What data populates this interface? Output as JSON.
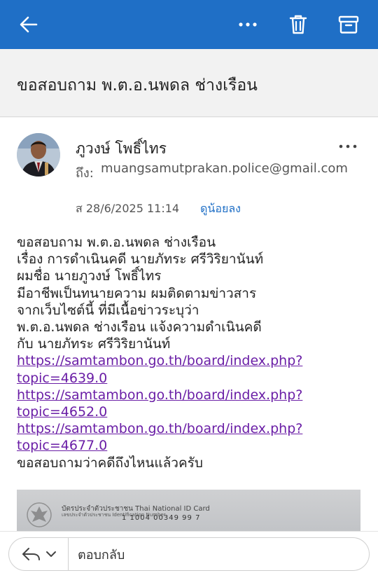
{
  "toolbar": {
    "back_icon": "arrow-left-icon",
    "more_icon": "more-horizontal-icon",
    "delete_icon": "trash-icon",
    "archive_icon": "archive-icon",
    "color": "#1f6fc6"
  },
  "email": {
    "subject": "ขอสอบถาม พ.ต.อ.นพดล ช่างเรือน",
    "sender_name": "ภูวงษ์ โพธิ์ไทร",
    "to_label": "ถึง:",
    "to_address": "muangsamutprakan.police@gmail.com",
    "date": "ส 28/6/2025 11:14",
    "show_less": "ดูน้อยลง",
    "body_lines": [
      "ขอสอบถาม พ.ต.อ.นพดล ช่างเรือน",
      "เรื่อง การดำเนินคดี นายภัทระ ศรีวิริยานันท์",
      "ผมชื่อ นายภูวงษ์ โพธิ์ไทร",
      "มีอาชีพเป็นทนายความ ผมติดตามข่าวสาร",
      "จากเว็บไซต์นี้ ที่มีเนื้อข่าวระบุว่า",
      "พ.ต.อ.นพดล ช่างเรือน แจ้งความดำเนินคดี",
      "กับ นายภัทระ ศรีวิริยานันท์"
    ],
    "links": [
      {
        "line1": "https://samtambon.go.th/board/index.php?",
        "line2": "topic=4639.0"
      },
      {
        "line1": "https://samtambon.go.th/board/index.php?",
        "line2": "topic=4652.0"
      },
      {
        "line1": "https://samtambon.go.th/board/index.php?",
        "line2": "topic=4677.0"
      }
    ],
    "closing": "ขอสอบถามว่าคดีถึงไหนแล้วครับ",
    "link_color": "#6a1ea6",
    "attachment": {
      "title": "บัตรประจำตัวประชาชน Thai National ID Card",
      "id_label": "เลขประจำตัวประชาชน Identification Number",
      "id_number": "1 1004 00349 99 7"
    }
  },
  "reply": {
    "placeholder": "ตอบกลับ",
    "icon": "reply-icon"
  }
}
